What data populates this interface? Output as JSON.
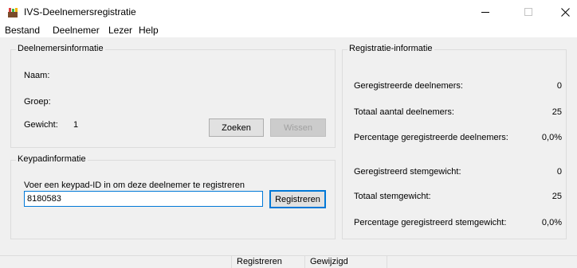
{
  "window": {
    "title": "IVS-Deelnemersregistratie"
  },
  "menu": {
    "items": [
      "Bestand",
      "Deelnemer",
      "Lezer",
      "Help"
    ]
  },
  "participant_info": {
    "group_title": "Deelnemersinformatie",
    "name_label": "Naam:",
    "group_label": "Groep:",
    "weight_label": "Gewicht:",
    "weight_value": "1",
    "search_button": "Zoeken",
    "clear_button": "Wissen"
  },
  "keypad_info": {
    "group_title": "Keypadinformatie",
    "instruction": "Voer een keypad-ID in om deze deelnemer te registreren",
    "keypad_id_value": "8180583",
    "register_button": "Registreren"
  },
  "registration_info": {
    "group_title": "Registratie-informatie",
    "rows": [
      {
        "label": "Geregistreerde deelnemers:",
        "value": "0"
      },
      {
        "label": "Totaal aantal deelnemers:",
        "value": "25"
      },
      {
        "label": "Percentage geregistreerde deelnemers:",
        "value": "0,0%"
      },
      {
        "label": "Geregistreerd stemgewicht:",
        "value": "0"
      },
      {
        "label": "Totaal stemgewicht:",
        "value": "25"
      },
      {
        "label": "Percentage geregistreerd stemgewicht:",
        "value": "0,0%"
      }
    ]
  },
  "statusbar": {
    "mode": "Registreren",
    "state": "Gewijzigd"
  },
  "colors": {
    "accent": "#0078d7",
    "background": "#f0f0f0"
  }
}
